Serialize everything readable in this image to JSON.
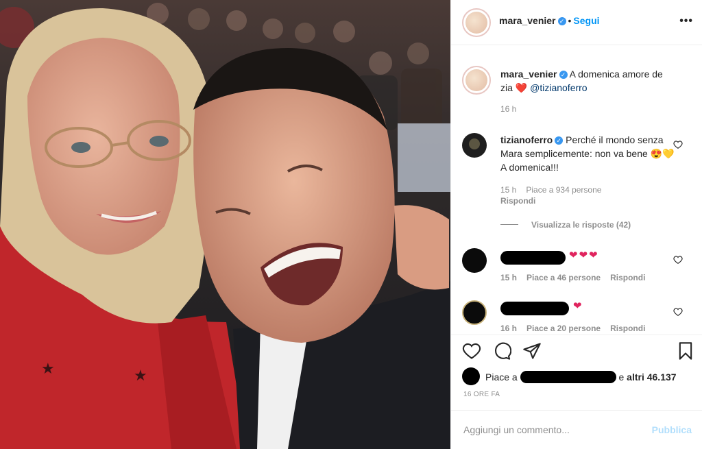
{
  "post": {
    "username": "mara_venier",
    "verified_glyph": "✓",
    "follow_separator": "•",
    "follow_label": "Segui",
    "more_glyph": "•••"
  },
  "caption": {
    "username": "mara_venier",
    "text": "A domenica amore de zia ",
    "mention": "@tizianoferro",
    "time": "16 h"
  },
  "comments": [
    {
      "username": "tizianoferro",
      "text": "Perché il mondo senza Mara semplicemente: non va bene 😍💛A domenica!!!",
      "time": "15 h",
      "likes": "Piace a 934 persone",
      "reply": "Rispondi",
      "view_replies": "Visualizza le risposte (42)"
    },
    {
      "username": "",
      "text": "",
      "time": "15 h",
      "likes": "Piace a 46 persone",
      "reply": "Rispondi"
    },
    {
      "username": "",
      "text": "",
      "time": "16 h",
      "likes": "Piace a 20 persone",
      "reply": "Rispondi"
    }
  ],
  "likes": {
    "prefix": "Piace a",
    "suffix": "e",
    "others": "altri 46.137"
  },
  "timestamp": "16 ORE FA",
  "add_comment": {
    "placeholder": "Aggiungi un commento...",
    "publish": "Pubblica"
  },
  "colors": {
    "accent": "#0095f6",
    "heart": "#ed4956",
    "muted": "#8e8e8e",
    "publish_disabled": "#b2dffc"
  }
}
